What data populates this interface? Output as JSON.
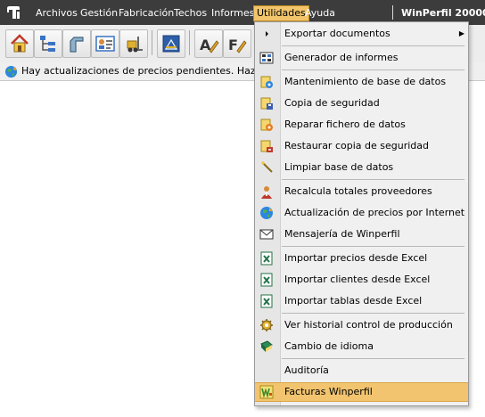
{
  "menubar": {
    "items": [
      {
        "label": "Archivos"
      },
      {
        "label": "Gestión"
      },
      {
        "label": "Fabricación"
      },
      {
        "label": "Techos"
      },
      {
        "label": "Informes"
      },
      {
        "label": "Utilidades"
      },
      {
        "label": "Ayuda"
      }
    ],
    "active_item": "Utilidades",
    "window_title": "WinPerfil 20000 -"
  },
  "toolbar": {
    "icons": [
      "home-icon",
      "tree-icon",
      "profile-icon",
      "id-card-icon",
      "forklift-icon",
      "blueprint-icon",
      "edit-icon",
      "edit-formula-icon"
    ]
  },
  "notification": {
    "text": "Hay actualizaciones de precios pendientes. Haz cl"
  },
  "dropdown": {
    "items": [
      {
        "label": "Exportar documentos",
        "icon": "export-icon",
        "submenu": true
      },
      {
        "label": "Generador de informes",
        "icon": "report-generator-icon"
      },
      {
        "label": "Mantenimiento de base de datos",
        "icon": "db-maintenance-icon"
      },
      {
        "label": "Copia de seguridad",
        "icon": "backup-icon"
      },
      {
        "label": "Reparar fichero de datos",
        "icon": "repair-file-icon"
      },
      {
        "label": "Restaurar copia de seguridad",
        "icon": "restore-icon"
      },
      {
        "label": "Limpiar base de datos",
        "icon": "wand-icon"
      },
      {
        "label": "Recalcula totales proveedores",
        "icon": "supplier-icon"
      },
      {
        "label": "Actualización de precios por Internet",
        "icon": "globe-icon"
      },
      {
        "label": "Mensajería de Winperfil",
        "icon": "mail-icon"
      },
      {
        "label": "Importar precios desde Excel",
        "icon": "excel-icon"
      },
      {
        "label": "Importar clientes desde Excel",
        "icon": "excel-icon"
      },
      {
        "label": "Importar tablas desde Excel",
        "icon": "excel-icon"
      },
      {
        "label": "Ver historial control de producción",
        "icon": "gear-icon"
      },
      {
        "label": "Cambio de idioma",
        "icon": "book-icon"
      },
      {
        "label": "Auditoría",
        "icon": ""
      },
      {
        "label": "Facturas Winperfil",
        "icon": "invoice-icon",
        "highlighted": true
      }
    ]
  },
  "colors": {
    "menubar_bg": "#3c3c3c",
    "highlight": "#f2c46f",
    "menu_bg": "#f0f0f0"
  }
}
